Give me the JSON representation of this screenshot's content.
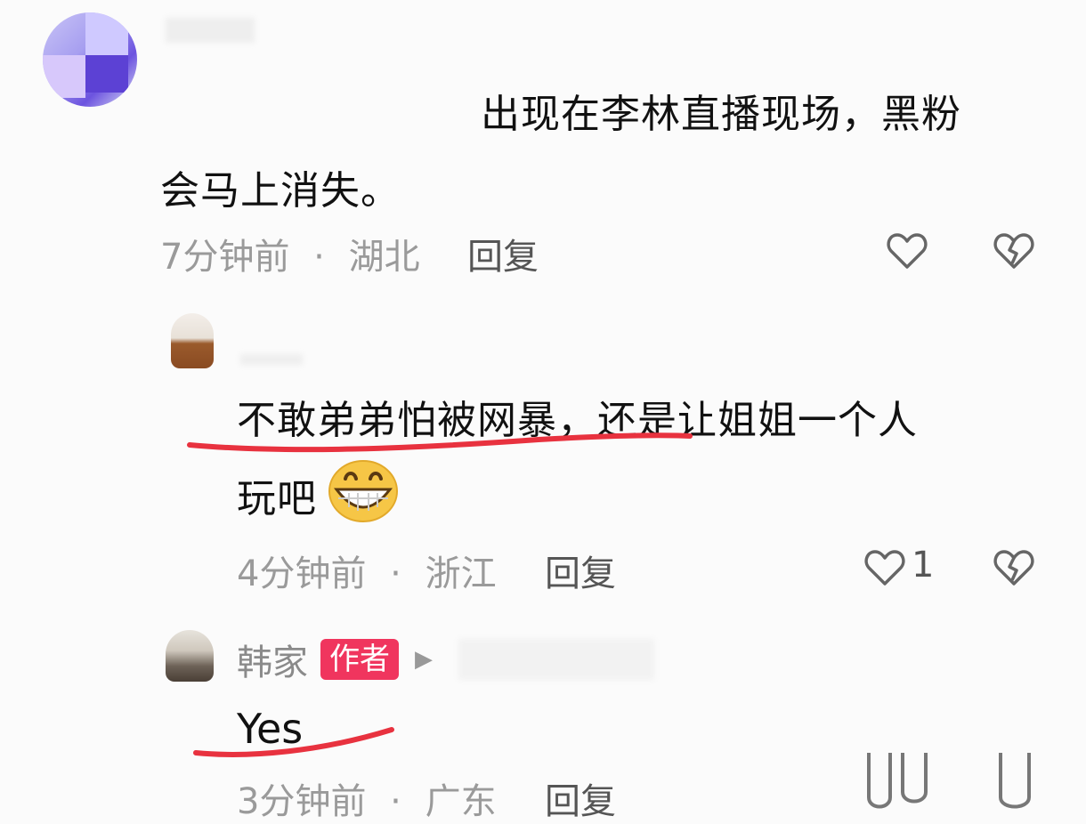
{
  "comments": [
    {
      "text_line1": "出现在李林直播现场，黑粉",
      "text_line2": "会马上消失。",
      "time": "7分钟前",
      "location": "湖北",
      "reply_label": "回复",
      "likes": ""
    },
    {
      "text_line1": "不敢弟弟怕被网暴，还是让姐姐一个人",
      "text_line2": "玩吧",
      "emoji": "grinning-emoji",
      "time": "4分钟前",
      "location": "浙江",
      "reply_label": "回复",
      "likes": "1"
    },
    {
      "username": "韩家",
      "badge": "作者",
      "text_line1": "Yes",
      "time": "3分钟前",
      "location": "广东",
      "reply_label": "回复"
    }
  ],
  "separator": "·",
  "colors": {
    "accent_underline": "#e8323f",
    "badge": "#f0355e"
  }
}
